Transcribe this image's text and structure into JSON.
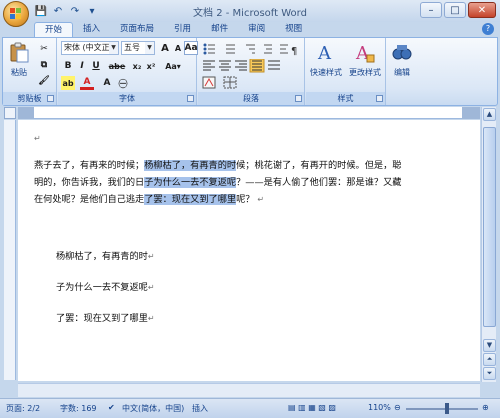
{
  "window": {
    "title": "文档 2 - Microsoft Word",
    "minimize": "–",
    "maximize": "□",
    "close": "✕"
  },
  "qat": {
    "save": "💾",
    "undo": "↶",
    "redo": "↷",
    "more": "▾"
  },
  "tabs": [
    "开始",
    "插入",
    "页面布局",
    "引用",
    "邮件",
    "审阅",
    "视图"
  ],
  "active_tab": "开始",
  "ribbon": {
    "clipboard": {
      "label": "剪贴板",
      "paste_label": "粘贴"
    },
    "font": {
      "label": "字体",
      "font_name": "宋体 (中文正)",
      "font_size": "五号",
      "bold": "B",
      "italic": "I",
      "underline": "U",
      "strike": "abe",
      "sub": "x₂",
      "sup": "x²",
      "clear": "Aa",
      "grow": "A",
      "shrink": "A",
      "font_color": "A",
      "highlight": "ab"
    },
    "paragraph": {
      "label": "段落"
    },
    "styles": {
      "label": "样式",
      "quick_styles": "快速样式",
      "change_styles": "更改样式"
    },
    "editing": {
      "label": "编辑"
    }
  },
  "document": {
    "paragraph1": {
      "line1_before": "燕子去了，有再来的时候；",
      "line1_hl": "杨柳枯了，有再青的时",
      "line1_after": "候；桃花谢了，有再开的时候。但是，聪",
      "line2_before": "明的，你告诉我，我们的日",
      "line2_hl": "子为什么一去不复返呢",
      "line2_after": "？——是有人偷了他们罢：那是谁？又藏",
      "line3_before": "在何处呢？是他们自己逃走",
      "line3_hl": "了罢：现在又到了哪里",
      "line3_after": "呢？"
    },
    "extract1": "杨柳枯了，有再青的时",
    "extract2": "子为什么一去不复返呢",
    "extract3": "了罢：现在又到了哪里",
    "para_mark": "↵"
  },
  "statusbar": {
    "page": "页面: 2/2",
    "words": "字数: 169",
    "language": "中文(简体，中国)",
    "mode": "插入",
    "zoom": "110%"
  },
  "colors": {
    "selection": "#a6c2eb",
    "ribbon_text": "#15428b"
  }
}
